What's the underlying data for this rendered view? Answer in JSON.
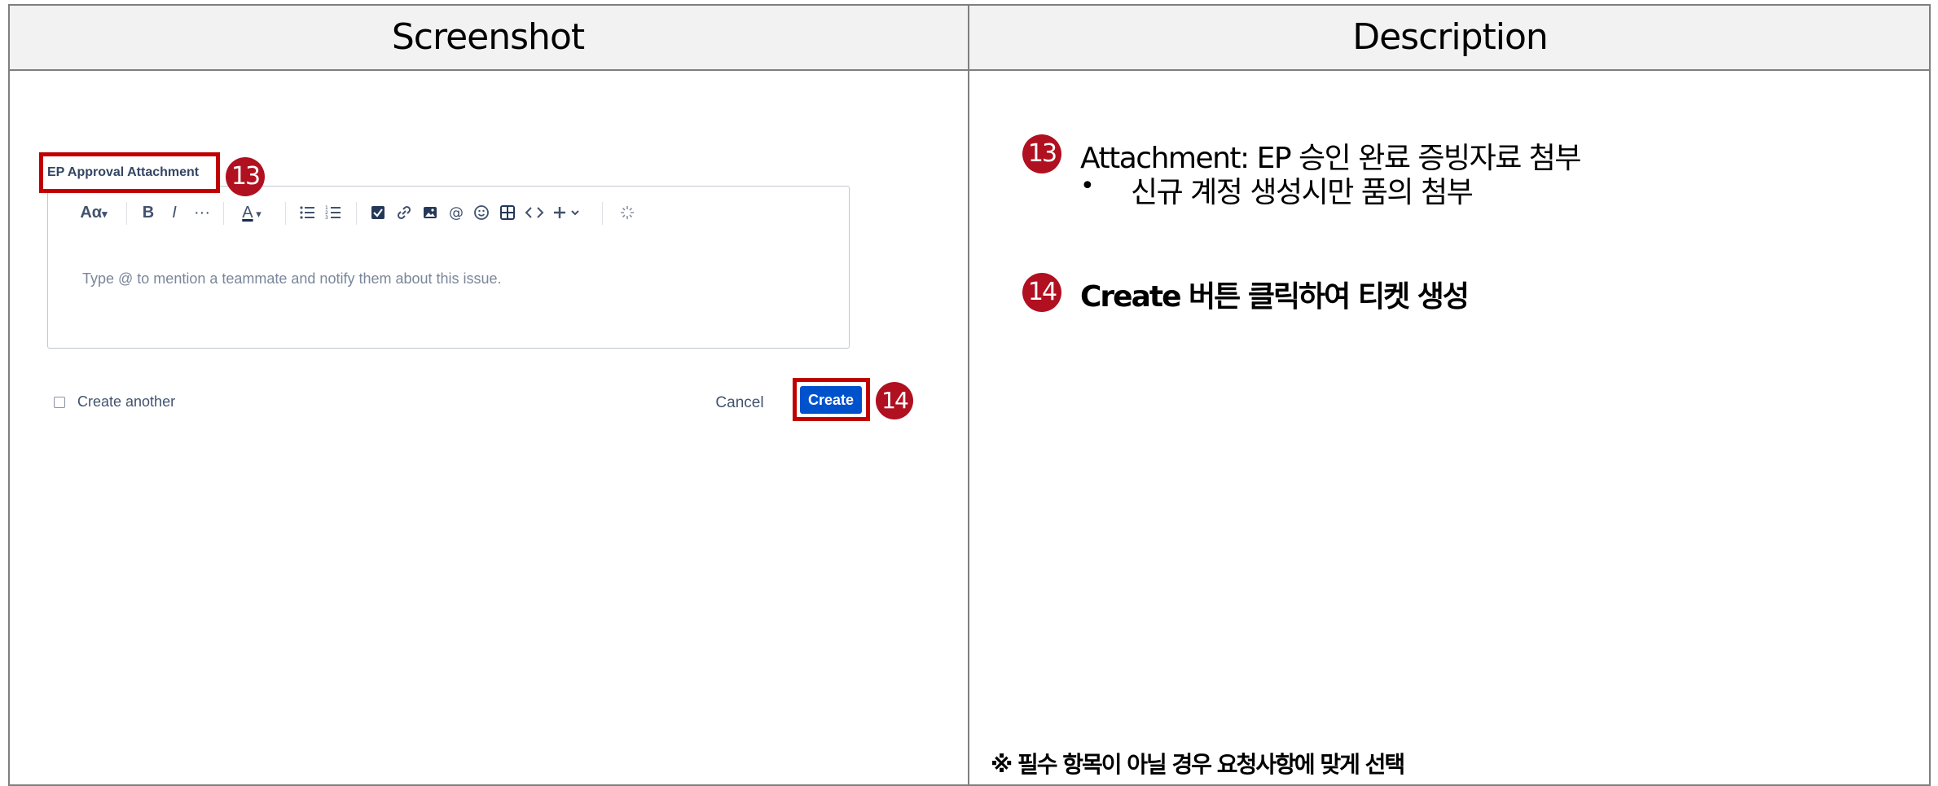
{
  "headers": {
    "left": "Screenshot",
    "right": "Description"
  },
  "screenshot": {
    "field_label": "EP Approval Attachment",
    "badges": {
      "attachment": "13",
      "create": "14"
    },
    "toolbar": {
      "text_style": "Aα",
      "bold": "B",
      "italic": "I",
      "more": "···",
      "text_color": "A",
      "icons": [
        "text-style-icon",
        "bold-icon",
        "italic-icon",
        "more-formatting-icon",
        "text-color-icon",
        "bullet-list-icon",
        "numbered-list-icon",
        "action-item-icon",
        "link-icon",
        "image-icon",
        "mention-icon",
        "emoji-icon",
        "table-icon",
        "code-icon",
        "insert-plus-icon",
        "ai-sparkle-icon"
      ]
    },
    "editor_placeholder": "Type @ to mention a teammate and notify them about this issue.",
    "create_another_label": "Create another",
    "cancel_label": "Cancel",
    "create_label": "Create"
  },
  "description": {
    "item13_title": "Attachment:",
    "item13_text": " EP 승인 완료 증빙자료 첨부",
    "item13_bullet": "신규 계정 생성시만 품의 첨부",
    "item14_text": "Create 버튼 클릭하여 티켓 생성",
    "note": "※ 필수 항목이 아닐 경우 요청사항에 맞게 선택"
  },
  "colors": {
    "badge": "#b01020",
    "highlight": "#c00000",
    "primary_button": "#0052cc",
    "header_bg": "#f2f2f2"
  }
}
